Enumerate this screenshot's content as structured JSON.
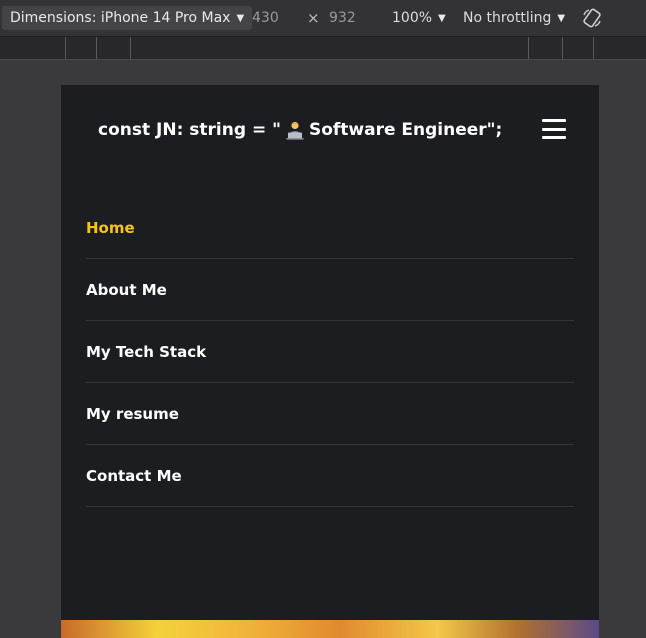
{
  "devtools": {
    "dimensions_label": "Dimensions: iPhone 14 Pro Max",
    "width": "430",
    "times": "×",
    "height": "932",
    "zoom": "100%",
    "throttling": "No throttling"
  },
  "site": {
    "brand": {
      "prefix": "const JN: string = \"",
      "suffix": " Software Engineer\";"
    },
    "nav": [
      {
        "label": "Home",
        "active": true
      },
      {
        "label": "About Me",
        "active": false
      },
      {
        "label": "My Tech Stack",
        "active": false
      },
      {
        "label": "My resume",
        "active": false
      },
      {
        "label": "Contact Me",
        "active": false
      }
    ],
    "accent_color": "#f7c21a",
    "background_color": "#1b1d20"
  }
}
